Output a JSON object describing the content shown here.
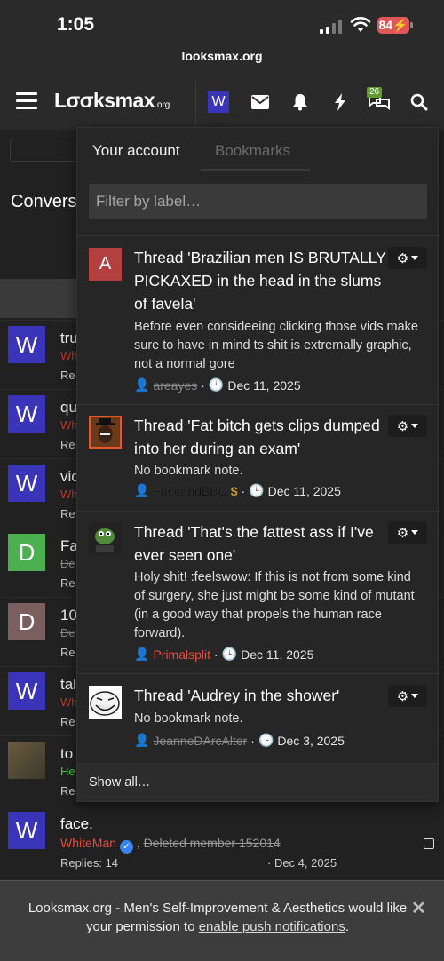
{
  "status_bar": {
    "time": "1:05",
    "battery": "84",
    "url": "looksmax.org"
  },
  "nav": {
    "logo": "Lσσksmax",
    "logo_suffix": ".org",
    "avatar_letter": "W",
    "conversations_badge": "26"
  },
  "background": {
    "page_title_fragment": "Convers",
    "rows": [
      {
        "avatar": "W",
        "color": "#3a34b8",
        "t1": "tru",
        "t2": "Wh",
        "t3": "Re"
      },
      {
        "avatar": "W",
        "color": "#3a34b8",
        "t1": "qu",
        "t2": "Wh",
        "t3": "Re"
      },
      {
        "avatar": "W",
        "color": "#3a34b8",
        "t1": "vic",
        "t2": "Wh",
        "t3": "Re"
      },
      {
        "avatar": "D",
        "color": "#4caf50",
        "t1": "Fa",
        "t2": "De",
        "t3": "Re"
      },
      {
        "avatar": "D",
        "color": "#7b5e5e",
        "t1": "10",
        "t2": "De",
        "t3": "Re"
      },
      {
        "avatar": "W",
        "color": "#3a34b8",
        "t1": "tal",
        "t2": "Wh",
        "t3": "Re"
      },
      {
        "avatar": "",
        "color": "#4a4a3a",
        "t1": "to",
        "t2": "He",
        "t3": "Re"
      }
    ],
    "last_row": {
      "avatar": "W",
      "title": "face.",
      "author": "WhiteMan",
      "separator": ",",
      "deleted_member": "Deleted member 152014",
      "replies": "Replies: 14",
      "date": "· Dec 4, 2025"
    }
  },
  "menu": {
    "tabs": {
      "account": "Your account",
      "bookmarks": "Bookmarks"
    },
    "filter_placeholder": "Filter by label…",
    "bookmarks": [
      {
        "avatar_letter": "A",
        "avatar_color": "#b33f3f",
        "title": "Thread 'Brazilian men IS BRUTALLY PICKAXED in the head in the slums of favela'",
        "note": "Before even consideeing clicking those vids make sure to have in mind ts shit is extremally graphic, not a normal gore",
        "user": "areayes",
        "date": "Dec 11, 2025"
      },
      {
        "avatar_letter": "",
        "title": "Thread 'Fat bitch gets clips dumped into her during an exam'",
        "note": "No bookmark note.",
        "user": "FaceandBBC",
        "date": "Dec 11, 2025"
      },
      {
        "avatar_letter": "",
        "title": "Thread 'That's the fattest ass if I've ever seen one'",
        "note": "Holy shit! :feelswow: If this is not from some kind of surgery, she just might be some kind of mutant (in a good way that propels the human race forward).",
        "user": "Primalsplit",
        "date": "Dec 11, 2025"
      },
      {
        "avatar_letter": "",
        "title": "Thread 'Audrey in the shower'",
        "note": "No bookmark note.",
        "user": "JeanneDArcAlter",
        "date": "Dec 3, 2025"
      }
    ],
    "meta_separator": "·",
    "show_all": "Show all…"
  },
  "banner": {
    "text": "Looksmax.org - Men's Self-Improvement & Aesthetics would like your permission to ",
    "link": "enable push notifications",
    "tail": ".",
    "close": "✕"
  }
}
